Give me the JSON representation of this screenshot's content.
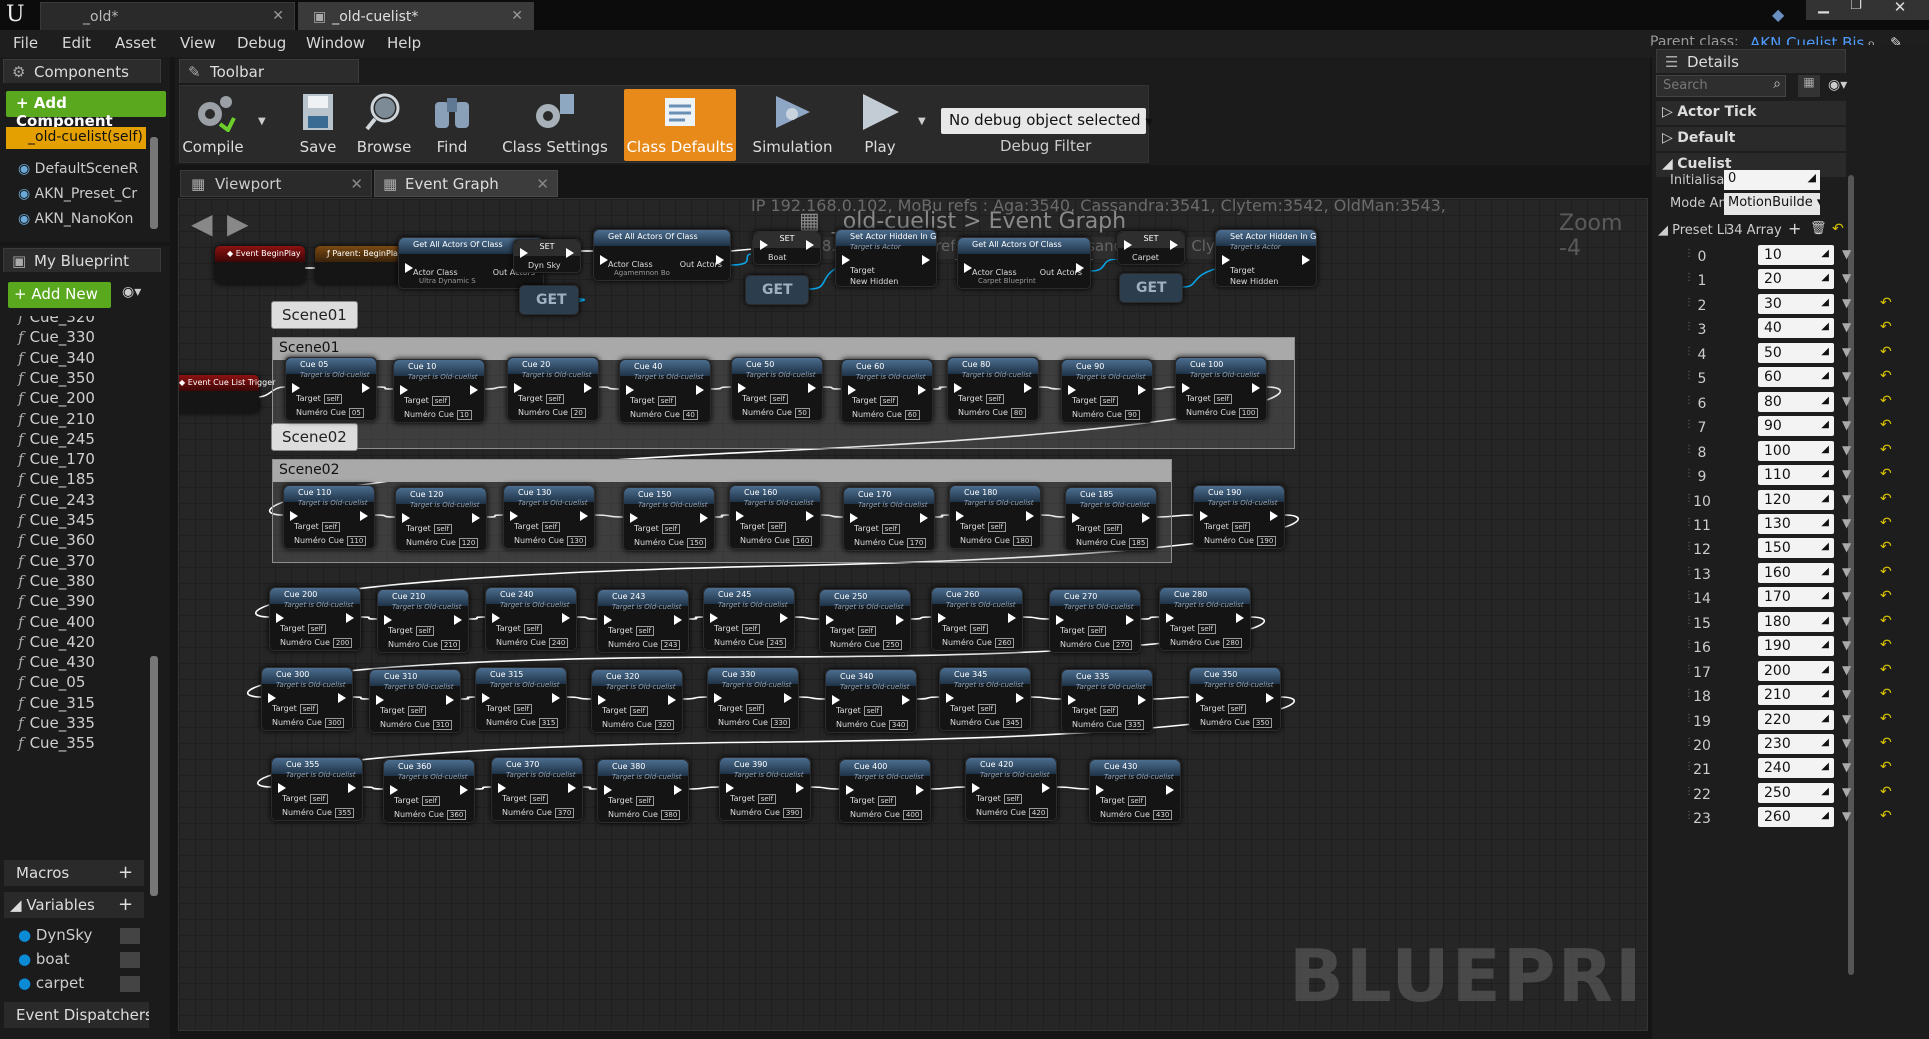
{
  "tabs": [
    {
      "label": "_old*"
    },
    {
      "label": "_old-cuelist*"
    }
  ],
  "parent_class": {
    "label": "Parent class:",
    "value": "AKN Cuelist Bis"
  },
  "menu": [
    "File",
    "Edit",
    "Asset",
    "View",
    "Debug",
    "Window",
    "Help"
  ],
  "components": {
    "title": "Components",
    "add_label": "+ Add Component",
    "root": "_old-cuelist(self)",
    "items": [
      "DefaultSceneR",
      "AKN_Preset_Cr",
      "AKN_NanoKon"
    ]
  },
  "toolbar": {
    "title": "Toolbar",
    "buttons": [
      "Compile",
      "Save",
      "Browse",
      "Find",
      "Class Settings",
      "Class Defaults",
      "Simulation",
      "Play"
    ],
    "debug_select": "No debug object selected",
    "debug_filter": "Debug Filter"
  },
  "my_blueprint": {
    "title": "My Blueprint",
    "add_new": "+ Add New",
    "functions": [
      "Cue_320",
      "Cue_330",
      "Cue_340",
      "Cue_350",
      "Cue_200",
      "Cue_210",
      "Cue_245",
      "Cue_170",
      "Cue_185",
      "Cue_243",
      "Cue_345",
      "Cue_360",
      "Cue_370",
      "Cue_380",
      "Cue_390",
      "Cue_400",
      "Cue_420",
      "Cue_430",
      "Cue_05",
      "Cue_315",
      "Cue_335",
      "Cue_355"
    ],
    "macros": "Macros",
    "variables": "Variables",
    "vars": [
      "DynSky",
      "boat",
      "carpet"
    ],
    "dispatchers": "Event Dispatchers"
  },
  "graph": {
    "viewport_tab": "Viewport",
    "event_tab": "Event Graph",
    "breadcrumb": "_old-cuelist > Event Graph",
    "zoom": "Zoom -4",
    "ip_line": "IP 192.168.0.102, MoBu refs : Aga:3540, Cassandra:3541, Clytem:3542, OldMan:3543,",
    "watermark": "BLUEPRINT",
    "top_nodes": {
      "begin_play": "Event BeginPlay",
      "parent_begin": "Parent: BeginPlay",
      "get_all_1": "Get All Actors Of Class",
      "class_1": "Ultra Dynamic S",
      "set_1": "SET",
      "set_1_pin": "Dyn Sky",
      "get_all_2": "Get All Actors Of Class",
      "class_2": "Agamemnon Bo",
      "set_2": "SET",
      "set_2_pin": "Boat",
      "set_hidden_1": "Set Actor Hidden In Game",
      "get_all_3": "Get All Actors Of Class",
      "class_3": "Carpet Blueprint",
      "set_3": "SET",
      "set_3_pin": "Carpet",
      "set_hidden_2": "Set Actor Hidden In Game",
      "get": "GET",
      "actor_class": "Actor Class",
      "out_actors": "Out Actors",
      "target": "Target",
      "target_is_actor": "Target is Actor",
      "new_hidden": "New Hidden"
    },
    "cue_trigger": "Event Cue List Trigger",
    "target_is": "Target is Old-cuelist",
    "pin_target": "Target",
    "pin_self": "self",
    "pin_num": "Numéro Cue",
    "scene01": "Scene01",
    "scene02": "Scene02",
    "rows": [
      [
        "05",
        "10",
        "20",
        "40",
        "50",
        "60",
        "80",
        "90",
        "100"
      ],
      [
        "110",
        "120",
        "130",
        "150",
        "160",
        "170",
        "180",
        "185",
        "190"
      ],
      [
        "200",
        "210",
        "240",
        "243",
        "245",
        "250",
        "260",
        "270",
        "280"
      ],
      [
        "300",
        "310",
        "315",
        "320",
        "330",
        "340",
        "345",
        "335",
        "350"
      ],
      [
        "355",
        "360",
        "370",
        "380",
        "390",
        "400",
        "420",
        "430"
      ]
    ]
  },
  "details": {
    "title": "Details",
    "search": "Search",
    "sections": [
      "Actor Tick",
      "Default",
      "Cuelist"
    ],
    "init_label": "Initialisat",
    "init_value": "0",
    "mode_label": "Mode Ani",
    "mode_value": "MotionBuilde",
    "preset_label": "Preset Li",
    "preset_count": "34 Array",
    "entries": [
      [
        "0",
        "10"
      ],
      [
        "1",
        "20"
      ],
      [
        "2",
        "30"
      ],
      [
        "3",
        "40"
      ],
      [
        "4",
        "50"
      ],
      [
        "5",
        "60"
      ],
      [
        "6",
        "80"
      ],
      [
        "7",
        "90"
      ],
      [
        "8",
        "100"
      ],
      [
        "9",
        "110"
      ],
      [
        "10",
        "120"
      ],
      [
        "11",
        "130"
      ],
      [
        "12",
        "150"
      ],
      [
        "13",
        "160"
      ],
      [
        "14",
        "170"
      ],
      [
        "15",
        "180"
      ],
      [
        "16",
        "190"
      ],
      [
        "17",
        "200"
      ],
      [
        "18",
        "210"
      ],
      [
        "19",
        "220"
      ],
      [
        "20",
        "230"
      ],
      [
        "21",
        "240"
      ],
      [
        "22",
        "250"
      ],
      [
        "23",
        "260"
      ]
    ]
  }
}
